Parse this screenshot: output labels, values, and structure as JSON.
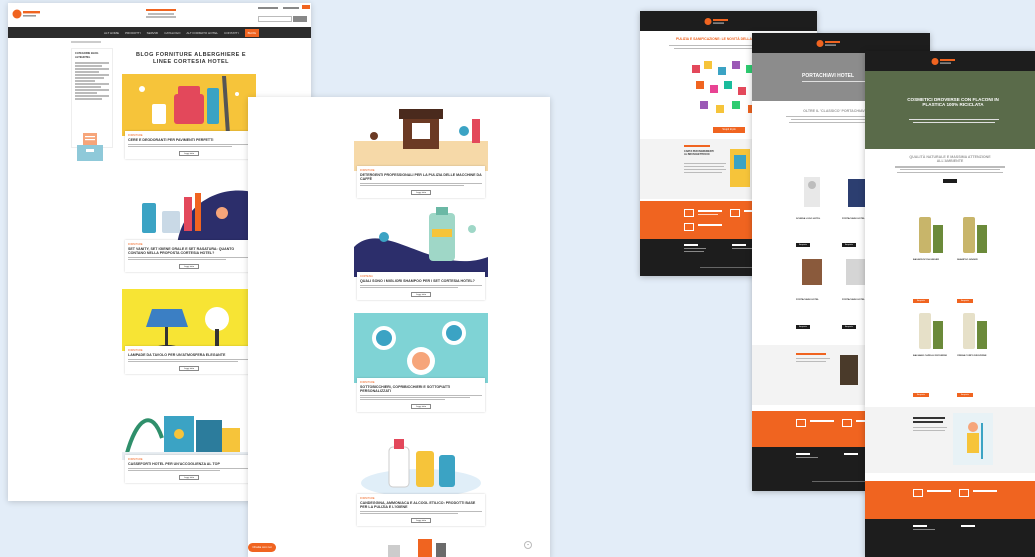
{
  "blog_page": {
    "title_line1": "BLOG FORNITURE ALBERGHIERE E",
    "title_line2": "LINEE CORTESIA HOTEL",
    "nav_items": [
      "ALT HOME",
      "PRODOTTI",
      "SERVIZI",
      "CATALOGO",
      "ALT FORMATO HOTEL",
      "CONTATTI",
      "BLOG"
    ],
    "sidebar_heading": "CATEGORIE BLOG ALTEHOTEL",
    "cards": [
      {
        "category": "FORNITURE",
        "title": "CERE E DEODORANTI PER PAVIMENTI PERFETTI",
        "button": "Leggi tutto"
      },
      {
        "category": "FORNITURE",
        "title": "SET VANITY, SET IGIENE ORALE E SET RASATURA: QUANTO CONTANO NELLA PROPOSTA CORTESIA HOTEL?",
        "button": "Leggi tutto"
      },
      {
        "category": "FORNITURE",
        "title": "LAMPADE DA TAVOLO PER UN'ATMOSFERA ELEGANTE",
        "button": "Leggi tutto"
      },
      {
        "category": "FORNITURE",
        "title": "CASSEFORTI HOTEL PER UN'ACCOGLIENZA AL TOP",
        "button": "Leggi tutto"
      }
    ]
  },
  "blog_page_2": {
    "cards": [
      {
        "category": "FORNITURE",
        "title": "DETERGENTI PROFESSIONALI PER LA PULIZIA DELLE MACCHINE DA CAFFÈ",
        "button": "Leggi tutto"
      },
      {
        "category": "CORTESIA",
        "title": "QUALI SONO I MIGLIORI SHAMPOO PER I SET CORTESIA HOTEL?",
        "button": "Leggi tutto"
      },
      {
        "category": "FORNITURE",
        "title": "SOTTOBICCHIERI, COPRIBICCHIERI E SOTTOPIATTI PERSONALIZZATI",
        "button": "Leggi tutto"
      },
      {
        "category": "FORNITURE",
        "title": "CANDEGGINA, AMMONIACA E ALCOOL ETILICO: PRODOTTI BASE PER LA PULIZIA E L'IGIENE",
        "button": "Leggi tutto"
      }
    ],
    "chat_button": "Chatta con noi"
  },
  "email_1": {
    "headline": "PULIZIA E SANIFICAZIONE: LE NOVITÀ DELLA NOSTRA GAMMA",
    "cta": "Scopri di più",
    "section_heading": "CARTA PER INGREDIENTI AL BRUSCHETTIFICIO"
  },
  "email_2": {
    "hero_title": "PORTACHIAVI HOTEL",
    "section_heading": "OLTRE IL 'CLASSICO' PORTACHIAVI HOTEL",
    "products": [
      "SCHEDA LOGO HOTEL",
      "PORTACHIAVI HOTEL",
      "PORTACHIAVI HOTEL",
      "PORTACHIAVI HOTEL"
    ],
    "button": "Acquista"
  },
  "email_3": {
    "hero_title": "COSMETICI DROVERSE CON FLACONI IN PLASTICA 100% RICICLATA",
    "section_heading": "QUALITÀ NATURALE E MASSIMA ATTENZIONE ALL'AMBIENTE",
    "products": [
      "BAGNODOCCIA GINGER",
      "SHAMPOO GINGER",
      "BALSAMO CAPELLI DROVERSE",
      "CREMA CORPO DROVERSE"
    ],
    "button": "Acquista"
  },
  "colors": {
    "accent": "#f06420",
    "dark": "#1d1d1d",
    "background": "#e3edf8"
  }
}
